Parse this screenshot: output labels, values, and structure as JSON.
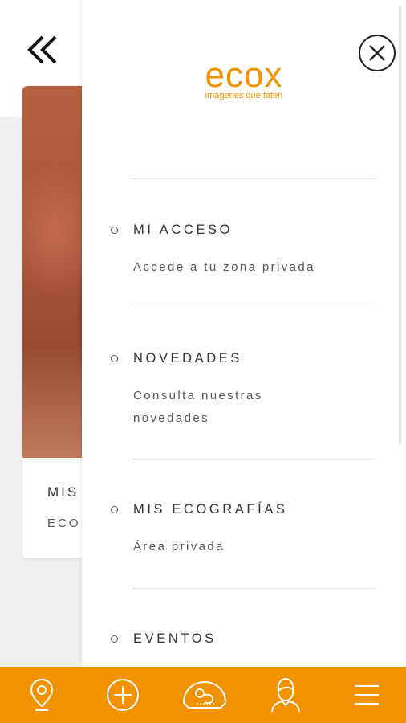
{
  "background": {
    "card_title": "MIS",
    "card_subtitle": "ECO"
  },
  "logo": {
    "name": "ecox",
    "tagline": "imágenes que faten"
  },
  "menu": [
    {
      "label": "MI ACCESO",
      "description": "Accede a tu zona privada"
    },
    {
      "label": "NOVEDADES",
      "description": "Consulta nuestras novedades"
    },
    {
      "label": "MIS ECOGRAFÍAS",
      "description": "Área privada"
    },
    {
      "label": "EVENTOS",
      "description": ""
    }
  ],
  "bottom_nav": [
    {
      "icon": "location-pin-icon"
    },
    {
      "icon": "add-circle-icon"
    },
    {
      "icon": "ultrasound-icon"
    },
    {
      "icon": "profile-woman-icon"
    },
    {
      "icon": "hamburger-menu-icon"
    }
  ],
  "colors": {
    "accent": "#f39200",
    "text": "#333333",
    "background": "#efefef"
  }
}
